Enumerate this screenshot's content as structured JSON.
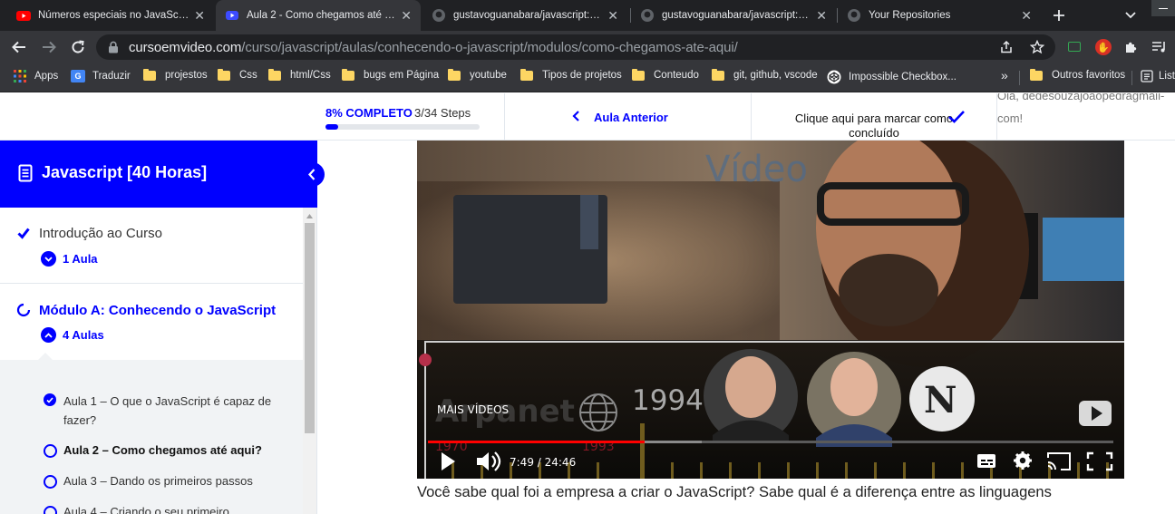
{
  "browser": {
    "tabs": [
      {
        "title": "Números especiais no JavaScript",
        "icon": "youtube-icon",
        "active": false
      },
      {
        "title": "Aula 2 - Como chegamos até aqui",
        "icon": "site-icon",
        "active": true
      },
      {
        "title": "gustavoguanabara/javascript: Cu",
        "icon": "github-icon",
        "active": false
      },
      {
        "title": "gustavoguanabara/javascript: Cu",
        "icon": "github-icon",
        "active": false
      },
      {
        "title": "Your Repositories",
        "icon": "github-icon",
        "active": false
      }
    ],
    "url_host": "cursoemvideo.com",
    "url_path": "/curso/javascript/aulas/conhecendo-o-javascript/modulos/como-chegamos-ate-aqui/",
    "bookmarks": [
      {
        "label": "Apps",
        "icon": "apps-grid-icon"
      },
      {
        "label": "Traduzir",
        "icon": "translate-icon"
      },
      {
        "label": "projestos",
        "icon": "folder-icon"
      },
      {
        "label": "Css",
        "icon": "folder-icon"
      },
      {
        "label": "html/Css",
        "icon": "folder-icon"
      },
      {
        "label": "bugs em Página",
        "icon": "folder-icon"
      },
      {
        "label": "youtube",
        "icon": "folder-icon"
      },
      {
        "label": "Tipos de projetos",
        "icon": "folder-icon"
      },
      {
        "label": "Conteudo",
        "icon": "folder-icon"
      },
      {
        "label": "git, github, vscode",
        "icon": "folder-icon"
      },
      {
        "label": "Impossible Checkbox...",
        "icon": "codepen-icon"
      }
    ],
    "bookmarks_overflow": "»",
    "other_bookmarks": "Outros favoritos",
    "reading_list": "List"
  },
  "course_bar": {
    "progress_label": "8% COMPLETO",
    "progress_steps": "3/34 Steps",
    "progress_fraction": 0.08,
    "prev_lesson": "Aula Anterior",
    "mark_complete": "Clique aqui para marcar como concluído",
    "greeting": "Olá, dedesouzajoaopedragmail-com!"
  },
  "sidebar": {
    "course_title": "Javascript [40 Horas]",
    "sections": [
      {
        "title": "Introdução ao Curso",
        "count": "1 Aula",
        "completed": true
      },
      {
        "title": "Módulo A: Conhecendo o JavaScript",
        "count": "4 Aulas",
        "completed": false
      }
    ],
    "lessons": [
      {
        "title": "Aula 1 – O que o JavaScript é capaz de fazer?",
        "done": true,
        "current": false
      },
      {
        "title": "Aula 2 – Como chegamos até aqui?",
        "done": false,
        "current": true
      },
      {
        "title": "Aula 3 – Dando os primeiros passos",
        "done": false,
        "current": false
      },
      {
        "title": "Aula 4 – Criando o seu primeiro",
        "done": false,
        "current": false
      }
    ]
  },
  "video": {
    "watermark": "Vídeo",
    "more_videos": "MAIS VÍDEOS",
    "year_badge": "1994",
    "timeline_years": [
      "1970",
      "1993"
    ],
    "time": "7:49 / 24:46",
    "progress_fraction": 0.316,
    "buffered_fraction": 0.4
  },
  "description": "Você sabe qual foi a empresa a criar o JavaScript? Sabe qual é a diferença entre as linguagens",
  "colors": {
    "accent": "#0000ff",
    "chrome_dark": "#202124",
    "chrome_mid": "#35363a",
    "yt_red": "#ff0000"
  }
}
